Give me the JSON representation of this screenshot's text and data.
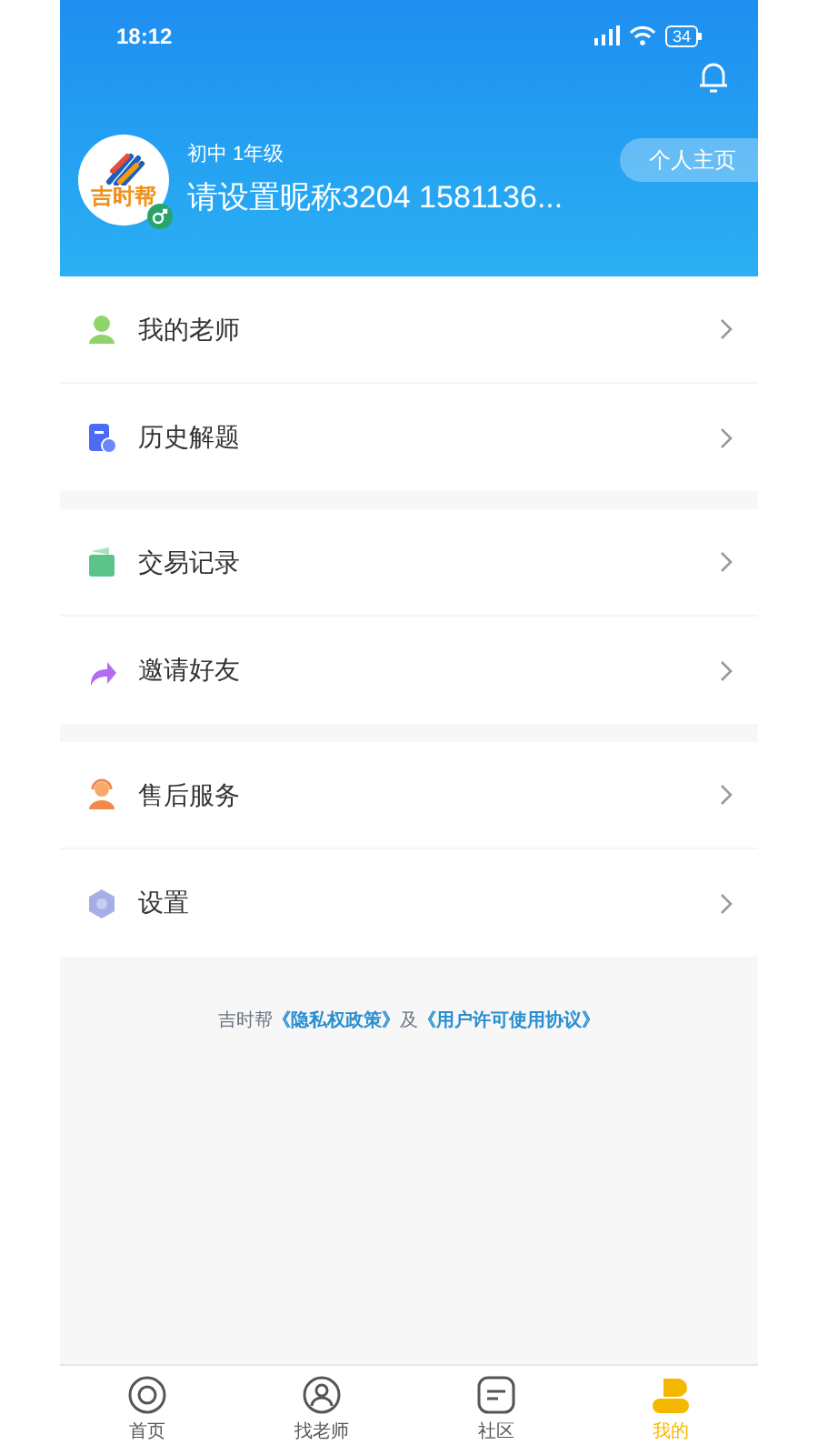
{
  "status_bar": {
    "time": "18:12",
    "battery": "34"
  },
  "profile": {
    "logo_text": "吉时帮",
    "grade": "初中 1年级",
    "nickname": "请设置昵称3204 1581136...",
    "home_button": "个人主页"
  },
  "menu_groups": [
    {
      "items": [
        {
          "label": "我的老师",
          "kind": "teacher"
        },
        {
          "label": "历史解题",
          "kind": "history"
        }
      ]
    },
    {
      "items": [
        {
          "label": "交易记录",
          "kind": "wallet"
        },
        {
          "label": "邀请好友",
          "kind": "share"
        }
      ]
    },
    {
      "items": [
        {
          "label": "售后服务",
          "kind": "service"
        },
        {
          "label": "设置",
          "kind": "settings"
        }
      ]
    }
  ],
  "footer": {
    "brand": "吉时帮",
    "privacy_link": "《隐私权政策》",
    "conjunction": "及",
    "license_link": "《用户许可使用协议》"
  },
  "tab_bar": [
    {
      "label": "首页",
      "kind": "home",
      "selected": false
    },
    {
      "label": "找老师",
      "kind": "teacher",
      "selected": false
    },
    {
      "label": "社区",
      "kind": "community",
      "selected": false
    },
    {
      "label": "我的",
      "kind": "mine",
      "selected": true
    }
  ]
}
